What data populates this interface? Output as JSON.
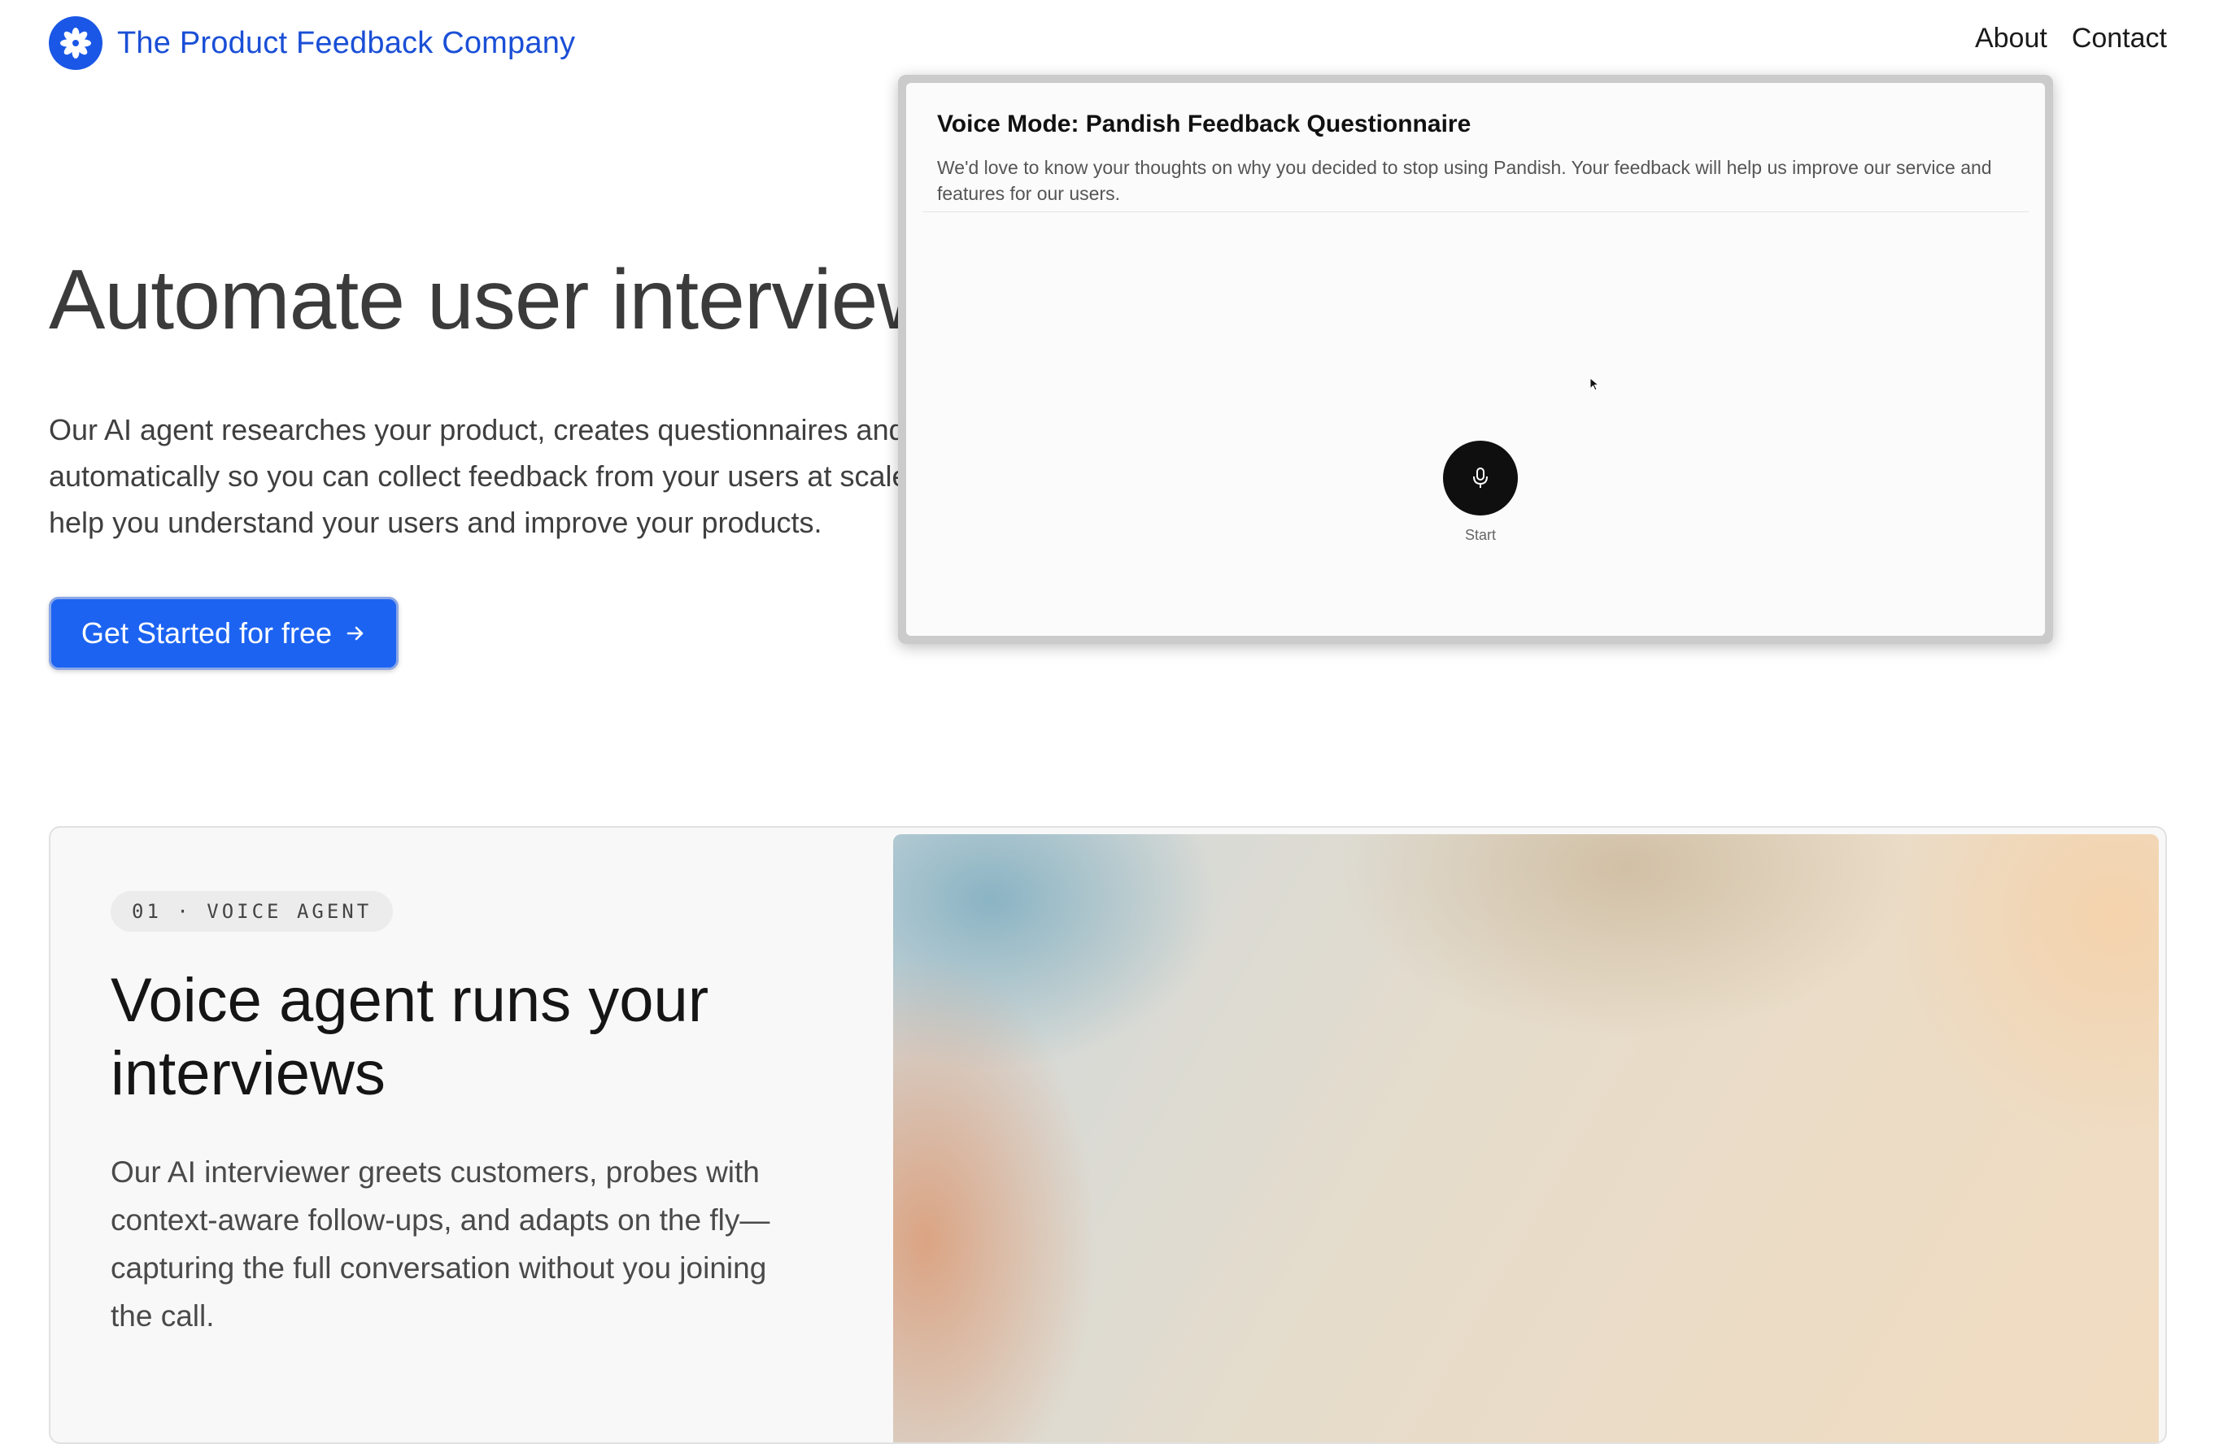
{
  "header": {
    "brand_name": "The Product Feedback Company",
    "nav": [
      {
        "label": "About"
      },
      {
        "label": "Contact"
      }
    ]
  },
  "hero": {
    "title": "Automate user interviews with AI",
    "description": "Our AI agent researches your product, creates questionnaires and conduct user interviews automatically so you can collect feedback from your users at scale. We provide analytical tools to help you understand your users and improve your products.",
    "cta_label": "Get Started for free",
    "cta_icon": "arrow-right-icon"
  },
  "feature": {
    "tag": "01 · VOICE AGENT",
    "title": "Voice agent runs your interviews",
    "description": "Our AI interviewer greets customers, probes with context-aware follow-ups, and adapts on the fly—capturing the full conversation without you joining the call.",
    "preview": {
      "title": "Voice Mode: Pandish Feedback Questionnaire",
      "description": "We'd love to know your thoughts on why you decided to stop using Pandish. Your feedback will help us improve our service and features for our users.",
      "mic_icon": "microphone-icon",
      "start_label": "Start"
    }
  },
  "colors": {
    "brand": "#1a57e6",
    "cta": "#1c63f2",
    "heading": "#3b3b3b"
  }
}
